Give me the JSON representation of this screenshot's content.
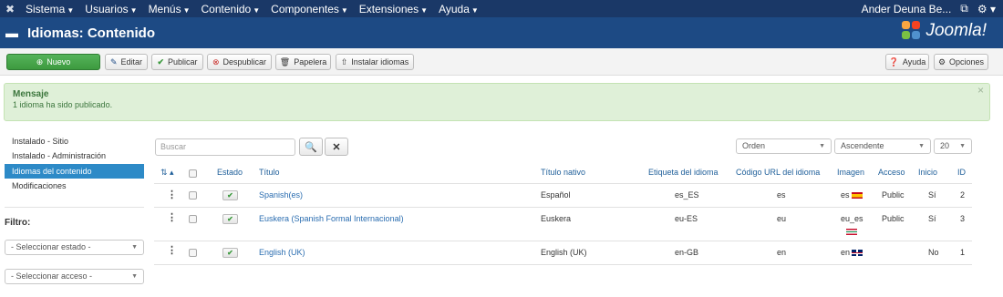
{
  "navbar": {
    "menu": [
      "Sistema",
      "Usuarios",
      "Menús",
      "Contenido",
      "Componentes",
      "Extensiones",
      "Ayuda"
    ],
    "user": "Ander Deuna Be...",
    "external_icon": "external-link-icon",
    "gear_icon": "gear-icon"
  },
  "header": {
    "title": "Idiomas: Contenido",
    "logo_text": "Joomla!"
  },
  "toolbar": {
    "new": "Nuevo",
    "edit": "Editar",
    "publish": "Publicar",
    "unpublish": "Despublicar",
    "trash": "Papelera",
    "install": "Instalar idiomas",
    "help": "Ayuda",
    "options": "Opciones"
  },
  "alert": {
    "heading": "Mensaje",
    "text": "1 idioma ha sido publicado."
  },
  "sidebar": {
    "items": [
      "Instalado - Sitio",
      "Instalado - Administración",
      "Idiomas del contenido",
      "Modificaciones"
    ],
    "active_index": 2,
    "filter_title": "Filtro:",
    "select_state": "- Seleccionar estado -",
    "select_access": "- Seleccionar acceso -"
  },
  "search": {
    "placeholder": "Buscar"
  },
  "list_controls": {
    "ordering": "Orden",
    "direction": "Ascendente",
    "limit": "20"
  },
  "table": {
    "columns": [
      "Estado",
      "Título",
      "Título nativo",
      "Etiqueta del idioma",
      "Código URL del idioma",
      "Imagen",
      "Acceso",
      "Inicio",
      "ID"
    ],
    "rows": [
      {
        "title": "Spanish(es)",
        "native": "Español",
        "tag": "es_ES",
        "sef": "es",
        "image": "es",
        "flag": "es",
        "access": "Public",
        "home": "Sí",
        "id": "2"
      },
      {
        "title": "Euskera (Spanish Formal Internacional)",
        "native": "Euskera",
        "tag": "eu-ES",
        "sef": "eu",
        "image": "eu_es",
        "flag": "eu",
        "access": "Public",
        "home": "Sí",
        "id": "3"
      },
      {
        "title": "English (UK)",
        "native": "English (UK)",
        "tag": "en-GB",
        "sef": "en",
        "image": "en",
        "flag": "uk",
        "access": "",
        "home": "No",
        "id": "1"
      }
    ]
  },
  "colors": {
    "navbar": "#1a3867",
    "header": "#1d4a84",
    "success": "#46a546",
    "alert_bg": "#dff0d8",
    "link": "#2a6db0",
    "sidebar_active": "#2d8ac7"
  }
}
